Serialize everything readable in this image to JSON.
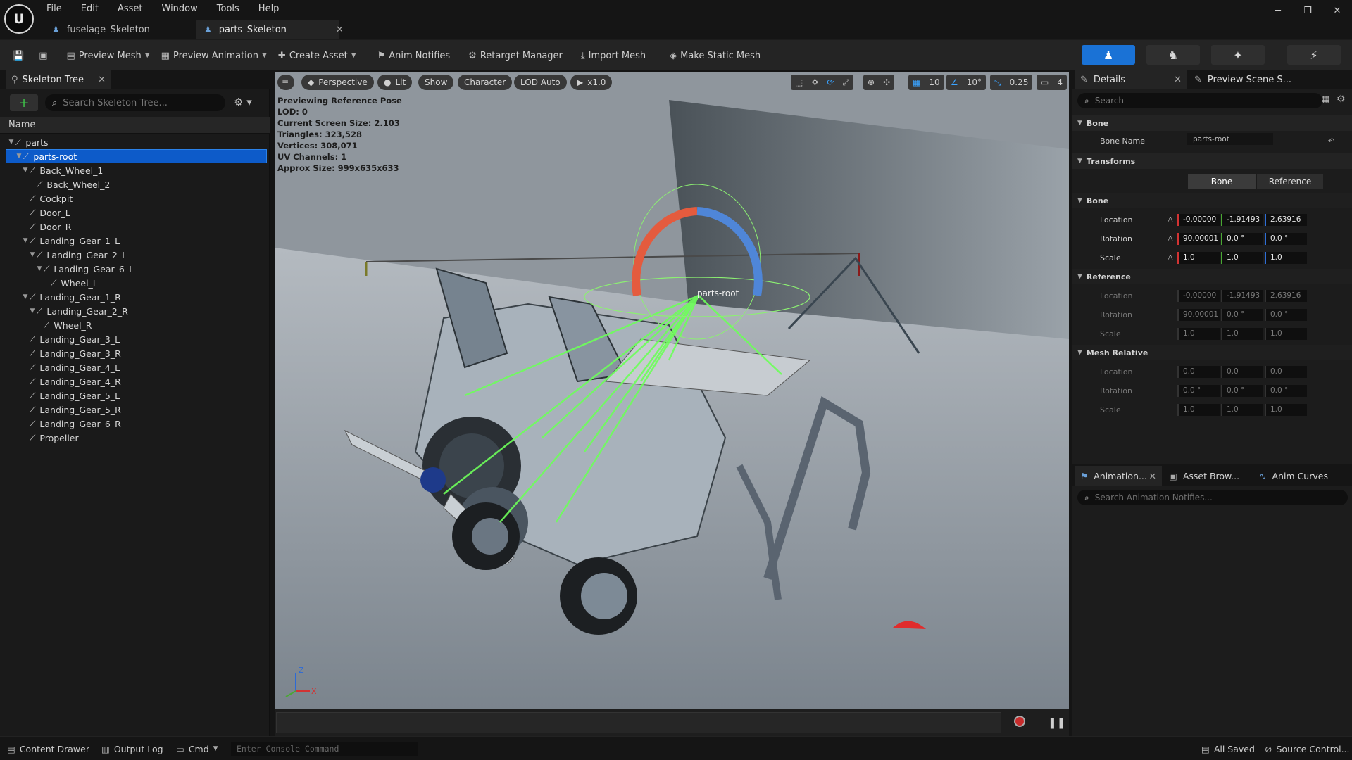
{
  "menu": [
    "File",
    "Edit",
    "Asset",
    "Window",
    "Tools",
    "Help"
  ],
  "tabs": [
    {
      "label": "fuselage_Skeleton",
      "active": false
    },
    {
      "label": "parts_Skeleton",
      "active": true
    }
  ],
  "toolbar": {
    "preview_mesh": "Preview Mesh",
    "preview_animation": "Preview Animation",
    "create_asset": "Create Asset",
    "anim_notifies": "Anim Notifies",
    "retarget_manager": "Retarget Manager",
    "import_mesh": "Import Mesh",
    "make_static_mesh": "Make Static Mesh"
  },
  "skeleton_tree": {
    "title": "Skeleton Tree",
    "search_placeholder": "Search Skeleton Tree...",
    "column": "Name",
    "bones": [
      {
        "name": "parts",
        "depth": 0,
        "expanded": true
      },
      {
        "name": "parts-root",
        "depth": 1,
        "expanded": true,
        "selected": true
      },
      {
        "name": "Back_Wheel_1",
        "depth": 2,
        "expanded": true
      },
      {
        "name": "Back_Wheel_2",
        "depth": 3
      },
      {
        "name": "Cockpit",
        "depth": 2
      },
      {
        "name": "Door_L",
        "depth": 2
      },
      {
        "name": "Door_R",
        "depth": 2
      },
      {
        "name": "Landing_Gear_1_L",
        "depth": 2,
        "expanded": true
      },
      {
        "name": "Landing_Gear_2_L",
        "depth": 3,
        "expanded": true
      },
      {
        "name": "Landing_Gear_6_L",
        "depth": 4,
        "expanded": true
      },
      {
        "name": "Wheel_L",
        "depth": 5
      },
      {
        "name": "Landing_Gear_1_R",
        "depth": 2,
        "expanded": true
      },
      {
        "name": "Landing_Gear_2_R",
        "depth": 3,
        "expanded": true
      },
      {
        "name": "Wheel_R",
        "depth": 4
      },
      {
        "name": "Landing_Gear_3_L",
        "depth": 2
      },
      {
        "name": "Landing_Gear_3_R",
        "depth": 2
      },
      {
        "name": "Landing_Gear_4_L",
        "depth": 2
      },
      {
        "name": "Landing_Gear_4_R",
        "depth": 2
      },
      {
        "name": "Landing_Gear_5_L",
        "depth": 2
      },
      {
        "name": "Landing_Gear_5_R",
        "depth": 2
      },
      {
        "name": "Landing_Gear_6_R",
        "depth": 2
      },
      {
        "name": "Propeller",
        "depth": 2
      }
    ]
  },
  "viewport": {
    "perspective": "Perspective",
    "lit": "Lit",
    "show": "Show",
    "character": "Character",
    "lod": "LOD Auto",
    "play_rate": "x1.0",
    "grid_snap": "10",
    "rot_snap": "10°",
    "scale_snap": "0.25",
    "cam_speed": "4",
    "stats": [
      "Previewing Reference Pose",
      "LOD: 0",
      "Current Screen Size: 2.103",
      "Triangles: 323,528",
      "Vertices: 308,071",
      "UV Channels: 1",
      "Approx Size: 999x635x633"
    ],
    "bone_label": "parts-root"
  },
  "details": {
    "tab": "Details",
    "tab2": "Preview Scene S...",
    "search_placeholder": "Search",
    "bone_section": "Bone",
    "bone_name_label": "Bone Name",
    "bone_name": "parts-root",
    "transforms_section": "Transforms",
    "btn_bone": "Bone",
    "btn_reference": "Reference",
    "sub_bone": "Bone",
    "sub_reference": "Reference",
    "sub_mesh_relative": "Mesh Relative",
    "location": "Location",
    "rotation": "Rotation",
    "scale": "Scale",
    "bone_loc": [
      "-0.00000",
      "-1.91493",
      "2.63916"
    ],
    "bone_rot": [
      "90.00001",
      "0.0 °",
      "0.0 °"
    ],
    "bone_scale": [
      "1.0",
      "1.0",
      "1.0"
    ],
    "ref_loc": [
      "-0.00000",
      "-1.91493",
      "2.63916"
    ],
    "ref_rot": [
      "90.00001",
      "0.0 °",
      "0.0 °"
    ],
    "ref_scale": [
      "1.0",
      "1.0",
      "1.0"
    ],
    "mesh_loc": [
      "0.0",
      "0.0",
      "0.0"
    ],
    "mesh_rot": [
      "0.0 °",
      "0.0 °",
      "0.0 °"
    ],
    "mesh_scale": [
      "1.0",
      "1.0",
      "1.0"
    ]
  },
  "lower_panel": {
    "tab1": "Animation...",
    "tab2": "Asset Brow...",
    "tab3": "Anim Curves",
    "search_placeholder": "Search Animation Notifies..."
  },
  "status": {
    "content_drawer": "Content Drawer",
    "output_log": "Output Log",
    "cmd": "Cmd",
    "console_placeholder": "Enter Console Command",
    "all_saved": "All Saved",
    "source_control": "Source Control..."
  }
}
